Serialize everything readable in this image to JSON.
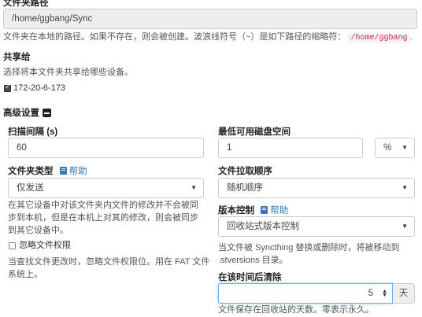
{
  "folder_path": {
    "label": "文件夹路径",
    "value": "/home/ggbang/Sync",
    "help": "文件夹在本地的路径。如果不存在，则会被创建。波浪线符号（~）是如下路径的缩略符：",
    "help_code": "/home/ggbang",
    "help_end": "."
  },
  "share": {
    "label": "共享给",
    "help": "选择将本文件夹共享给哪些设备。",
    "devices": [
      {
        "name": "172-20-6-173",
        "checked": true
      }
    ]
  },
  "advanced": {
    "label": "高级设置",
    "icon": "minus-square-icon"
  },
  "rescan": {
    "label": "扫描间隔 (s)",
    "value": "60"
  },
  "min_disk": {
    "label": "最低可用磁盘空间",
    "value": "1",
    "unit": "%"
  },
  "folder_type": {
    "label": "文件夹类型",
    "help_link": "帮助",
    "value": "仅发送",
    "help": "在其它设备中对该文件夹内文件的修改并不会被同步到本机，但是在本机上对其的修改，则会被同步到其它设备中。"
  },
  "pull_order": {
    "label": "文件拉取顺序",
    "value": "随机顺序"
  },
  "versioning": {
    "label": "版本控制",
    "help_link": "帮助",
    "value": "回收站式版本控制",
    "help": "当文件被 Syncthing 替换或删除时，将被移动到 .stversions 目录。"
  },
  "ignore_perms": {
    "label": "忽略文件权限",
    "checked": false,
    "help": "当查找文件更改时，忽略文件权限位。用在 FAT 文件系统上。"
  },
  "cleanout": {
    "label": "在该时间后清除",
    "value": "5",
    "unit": "天",
    "help": "文件保存在回收站的天数。零表示永久。"
  }
}
